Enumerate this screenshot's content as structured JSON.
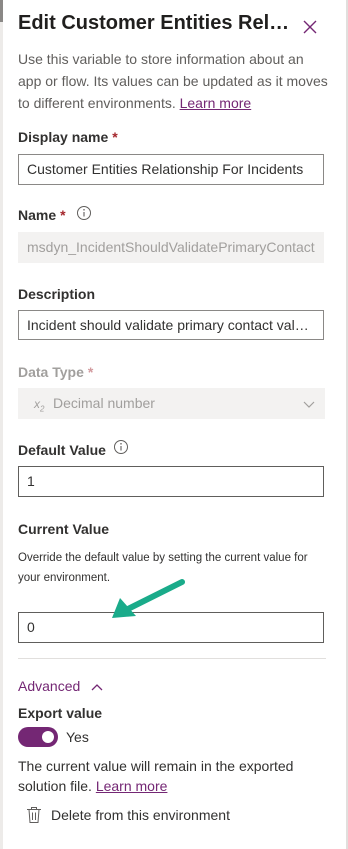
{
  "panel": {
    "title": "Edit Customer Entities Relationship For Incidents",
    "description": "Use this variable to store information about an app or flow. Its values can be updated as it moves to different environments.",
    "learn_more": "Learn more",
    "close_icon": "close-icon"
  },
  "fields": {
    "display_name": {
      "label": "Display name",
      "required_mark": "*",
      "value": "Customer Entities Relationship For Incidents"
    },
    "name": {
      "label": "Name",
      "required_mark": "*",
      "value": "msdyn_IncidentShouldValidatePrimaryContact",
      "info_icon": "info-icon"
    },
    "description": {
      "label": "Description",
      "value": "Incident should validate primary contact value for this environment"
    },
    "data_type": {
      "label": "Data Type",
      "required_mark": "*",
      "value": "Decimal number",
      "type_icon_glyph": "x",
      "type_icon_sub": "2"
    },
    "default_value": {
      "label": "Default Value",
      "value": "1",
      "info_icon": "info-icon"
    },
    "current_value": {
      "label": "Current Value",
      "hint": "Override the default value by setting the current value for your environment.",
      "value": "0"
    }
  },
  "advanced": {
    "label": "Advanced",
    "export_value": {
      "label": "Export value",
      "toggle_label": "Yes",
      "on": true
    },
    "note": "The current value will remain in the exported solution file.",
    "learn_more": "Learn more",
    "delete_label": "Delete from this environment",
    "delete_icon": "trash-icon"
  },
  "colors": {
    "accent": "#742774",
    "required": "#a4262c",
    "annotation_arrow": "#1aab8a"
  }
}
